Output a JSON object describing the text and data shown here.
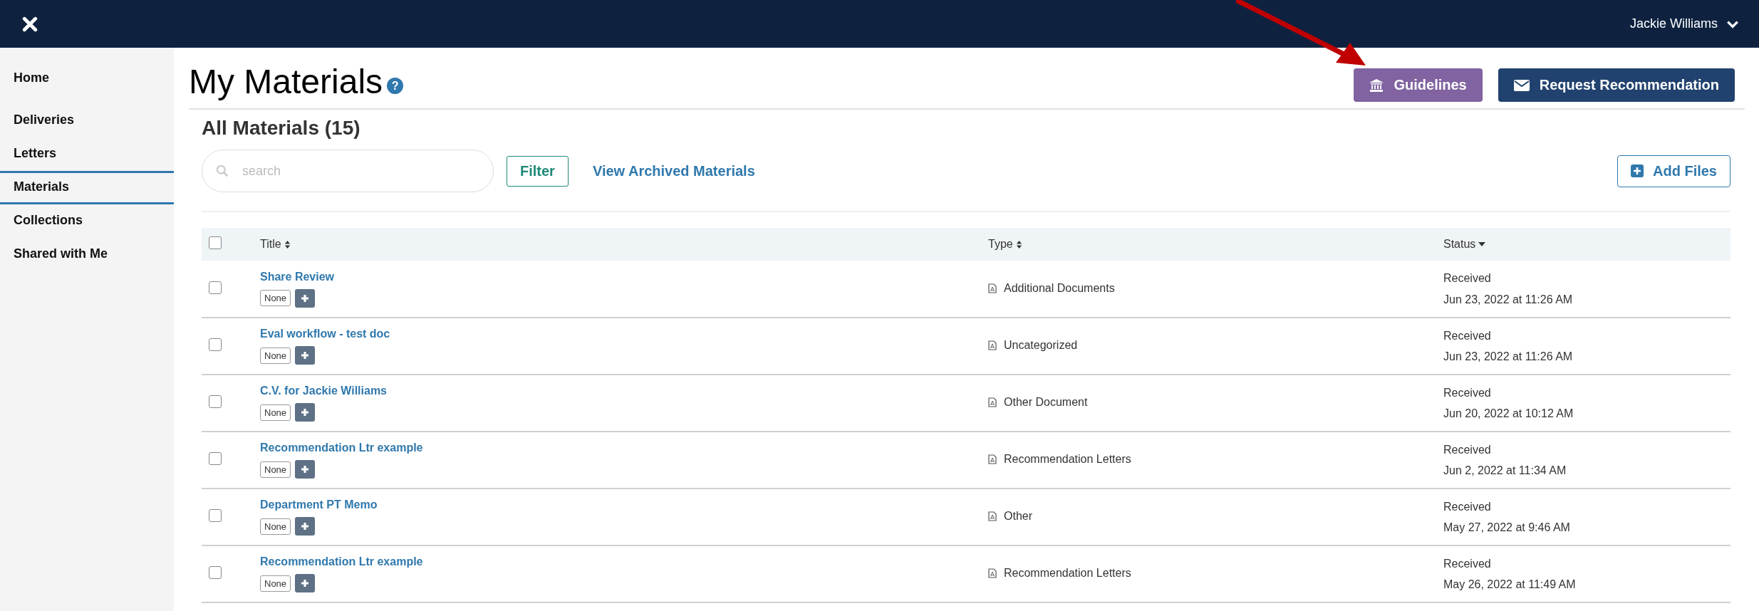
{
  "header": {
    "user_name": "Jackie Williams"
  },
  "sidebar": {
    "groups": [
      {
        "items": [
          {
            "label": "Home",
            "selected": false
          }
        ]
      },
      {
        "items": [
          {
            "label": "Deliveries",
            "selected": false
          },
          {
            "label": "Letters",
            "selected": false
          },
          {
            "label": "Materials",
            "selected": true
          },
          {
            "label": "Collections",
            "selected": false
          },
          {
            "label": "Shared with Me",
            "selected": false
          }
        ]
      }
    ]
  },
  "page": {
    "title": "My Materials",
    "help": "?",
    "buttons": [
      {
        "label": "Guidelines",
        "kind": "guidelines"
      },
      {
        "label": "Request Recommendation",
        "kind": "request"
      }
    ]
  },
  "section": {
    "title": "All Materials (15)",
    "search": {
      "placeholder": "search"
    },
    "filter": "Filter",
    "archived_link": "View Archived Materials",
    "add_files": "Add Files"
  },
  "table": {
    "all_checked": false,
    "columns": [
      {
        "label": "Title",
        "sorted": false
      },
      {
        "label": "Type",
        "sorted": false
      },
      {
        "label": "Status",
        "sorted": true
      }
    ],
    "rows": [
      {
        "checked": false,
        "title": "Share Review",
        "tag": "None",
        "type": "Additional Documents",
        "status": "Received",
        "date": "Jun 23, 2022 at 11:26 AM"
      },
      {
        "checked": false,
        "title": "Eval workflow - test doc",
        "tag": "None",
        "type": "Uncategorized",
        "status": "Received",
        "date": "Jun 23, 2022 at 11:26 AM"
      },
      {
        "checked": false,
        "title": "C.V. for Jackie Williams",
        "tag": "None",
        "type": "Other Document",
        "status": "Received",
        "date": "Jun 20, 2022 at 10:12 AM"
      },
      {
        "checked": false,
        "title": "Recommendation Ltr example",
        "tag": "None",
        "type": "Recommendation Letters",
        "status": "Received",
        "date": "Jun 2, 2022 at 11:34 AM"
      },
      {
        "checked": false,
        "title": "Department PT Memo",
        "tag": "None",
        "type": "Other",
        "status": "Received",
        "date": "May 27, 2022 at 9:46 AM"
      },
      {
        "checked": false,
        "title": "Recommendation Ltr example",
        "tag": "None",
        "type": "Recommendation Letters",
        "status": "Received",
        "date": "May 26, 2022 at 11:49 AM"
      }
    ]
  }
}
